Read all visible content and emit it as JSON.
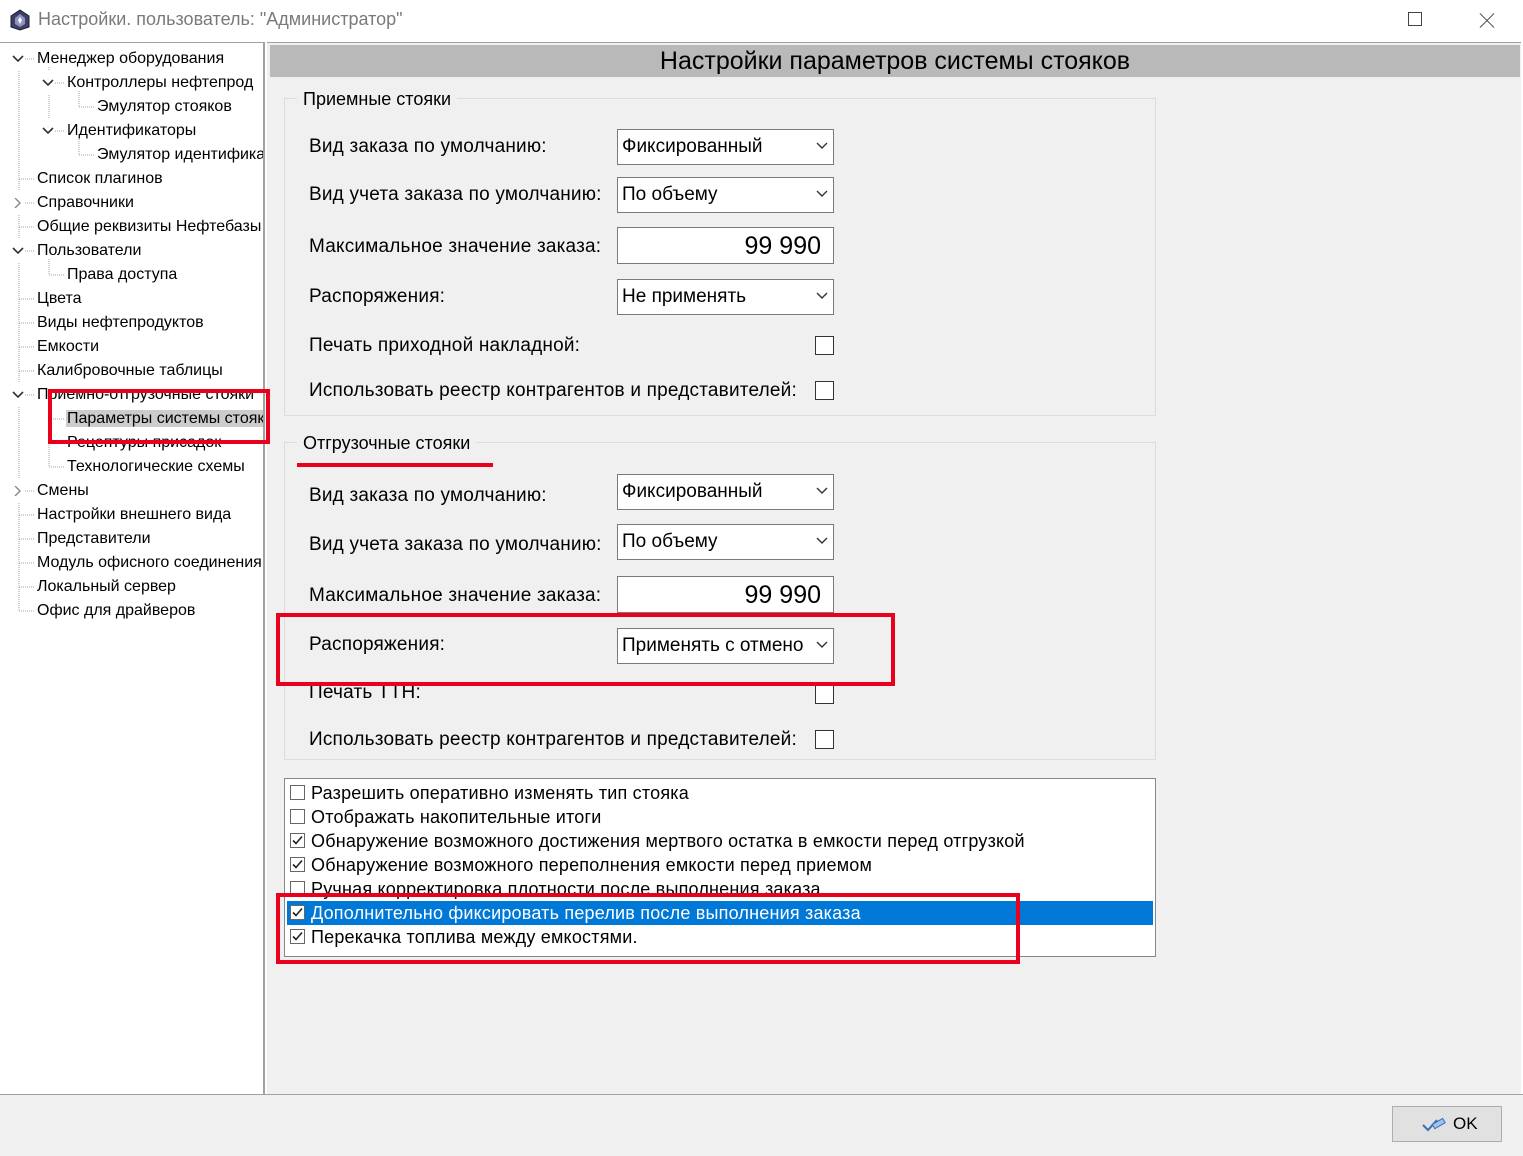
{
  "window": {
    "title": "Настройки. пользователь: \"Администратор\""
  },
  "tree": {
    "items": [
      {
        "label": "Менеджер оборудования",
        "level": 0,
        "expander": "expanded"
      },
      {
        "label": "Контроллеры нефтепрод",
        "level": 1,
        "expander": "expanded"
      },
      {
        "label": "Эмулятор стояков",
        "level": 2,
        "expander": "none"
      },
      {
        "label": "Идентификаторы",
        "level": 1,
        "expander": "expanded"
      },
      {
        "label": "Эмулятор идентифика",
        "level": 2,
        "expander": "none"
      },
      {
        "label": "Список плагинов",
        "level": 0,
        "expander": "none"
      },
      {
        "label": "Справочники",
        "level": 0,
        "expander": "collapsed"
      },
      {
        "label": "Общие реквизиты Нефтебазы",
        "level": 0,
        "expander": "none"
      },
      {
        "label": "Пользователи",
        "level": 0,
        "expander": "expanded"
      },
      {
        "label": "Права доступа",
        "level": 1,
        "expander": "none"
      },
      {
        "label": "Цвета",
        "level": 0,
        "expander": "none"
      },
      {
        "label": "Виды нефтепродуктов",
        "level": 0,
        "expander": "none"
      },
      {
        "label": "Емкости",
        "level": 0,
        "expander": "none"
      },
      {
        "label": "Калибровочные таблицы",
        "level": 0,
        "expander": "none"
      },
      {
        "label": "Приемно-отгрузочные стояки",
        "level": 0,
        "expander": "expanded"
      },
      {
        "label": "Параметры системы стояков",
        "level": 1,
        "expander": "none",
        "selected": true
      },
      {
        "label": "Рецептуры присадок",
        "level": 1,
        "expander": "none"
      },
      {
        "label": "Технологические схемы",
        "level": 1,
        "expander": "none"
      },
      {
        "label": "Смены",
        "level": 0,
        "expander": "collapsed"
      },
      {
        "label": "Настройки внешнего вида",
        "level": 0,
        "expander": "none"
      },
      {
        "label": "Представители",
        "level": 0,
        "expander": "none"
      },
      {
        "label": "Модуль офисного соединения",
        "level": 0,
        "expander": "none"
      },
      {
        "label": "Локальный сервер",
        "level": 0,
        "expander": "none"
      },
      {
        "label": "Офис для драйверов",
        "level": 0,
        "expander": "none"
      }
    ]
  },
  "page": {
    "title": "Настройки параметров системы стояков"
  },
  "receiving": {
    "legend": "Приемные стояки",
    "order_type_label": "Вид заказа по умолчанию:",
    "order_type_value": "Фиксированный",
    "accounting_label": "Вид учета заказа по умолчанию:",
    "accounting_value": "По объему",
    "max_order_label": "Максимальное значение заказа:",
    "max_order_value": "99 990",
    "orders_label": "Распоряжения:",
    "orders_value": "Не применять",
    "print_label": "Печать приходной накладной:",
    "print_checked": false,
    "registry_label": "Использовать реестр контрагентов и представителей:",
    "registry_checked": false
  },
  "shipping": {
    "legend": "Отгрузочные стояки",
    "order_type_label": "Вид заказа по умолчанию:",
    "order_type_value": "Фиксированный",
    "accounting_label": "Вид учета заказа по умолчанию:",
    "accounting_value": "По объему",
    "max_order_label": "Максимальное значение заказа:",
    "max_order_value": "99 990",
    "orders_label": "Распоряжения:",
    "orders_value": "Применять с отмено",
    "print_label": "Печать ТТН:",
    "print_checked": false,
    "registry_label": "Использовать реестр контрагентов и представителей:",
    "registry_checked": false
  },
  "options": [
    {
      "label": "Разрешить оперативно изменять тип стояка",
      "checked": false
    },
    {
      "label": "Отображать накопительные итоги",
      "checked": false
    },
    {
      "label": "Обнаружение возможного достижения мертвого остатка в емкости перед отгрузкой",
      "checked": true
    },
    {
      "label": "Обнаружение возможного переполнения емкости перед приемом",
      "checked": true
    },
    {
      "label": "Ручная корректировка плотности после выполнения заказа",
      "checked": false
    },
    {
      "label": "Дополнительно фиксировать перелив после выполнения заказа",
      "checked": true,
      "selected": true
    },
    {
      "label": "Перекачка топлива между емкостями.",
      "checked": true
    }
  ],
  "footer": {
    "ok_label": "OK"
  },
  "colors": {
    "selection": "#0078d7",
    "annotation": "#e8001c",
    "header_bar": "#b9b9b9"
  }
}
